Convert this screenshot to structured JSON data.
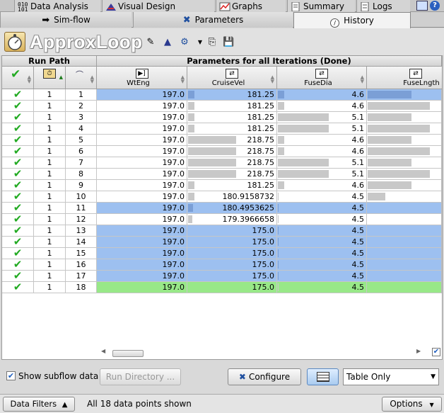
{
  "tabs_row1": [
    {
      "label": "Data Analysis",
      "icon": "data-analysis-icon"
    },
    {
      "label": "Visual Design",
      "icon": "visual-design-icon"
    },
    {
      "label": "Graphs",
      "icon": "graphs-icon"
    },
    {
      "label": "Summary",
      "icon": "summary-icon"
    },
    {
      "label": "Logs",
      "icon": "logs-icon"
    }
  ],
  "tabs_row2": [
    {
      "label": "Sim-flow",
      "icon": "arrow-right-icon"
    },
    {
      "label": "Parameters",
      "icon": "parameters-icon"
    },
    {
      "label": "History",
      "icon": "history-icon",
      "active": true
    }
  ],
  "title": "ApproxLoop",
  "table": {
    "group_run_path": "Run Path",
    "group_params": "Parameters for all Iterations (Done)",
    "columns": [
      "WtEng",
      "CruiseVel",
      "FuseDia",
      "FuseLngth"
    ],
    "rows": [
      {
        "run": "1",
        "iter": "1",
        "WtEng": "197.0",
        "CruiseVel": "181.25",
        "FuseDia": "4.6",
        "FuseLngth": "",
        "style": "blue",
        "bars": [
          0.0,
          0.07,
          0.07,
          0.6
        ]
      },
      {
        "run": "1",
        "iter": "2",
        "WtEng": "197.0",
        "CruiseVel": "181.25",
        "FuseDia": "4.6",
        "FuseLngth": "",
        "style": "white",
        "bars": [
          0.0,
          0.07,
          0.07,
          0.85
        ]
      },
      {
        "run": "1",
        "iter": "3",
        "WtEng": "197.0",
        "CruiseVel": "181.25",
        "FuseDia": "5.1",
        "FuseLngth": "",
        "style": "white",
        "bars": [
          0.0,
          0.07,
          0.58,
          0.6
        ]
      },
      {
        "run": "1",
        "iter": "4",
        "WtEng": "197.0",
        "CruiseVel": "181.25",
        "FuseDia": "5.1",
        "FuseLngth": "",
        "style": "white",
        "bars": [
          0.0,
          0.07,
          0.58,
          0.85
        ]
      },
      {
        "run": "1",
        "iter": "5",
        "WtEng": "197.0",
        "CruiseVel": "218.75",
        "FuseDia": "4.6",
        "FuseLngth": "",
        "style": "white",
        "bars": [
          0.0,
          0.55,
          0.07,
          0.6
        ]
      },
      {
        "run": "1",
        "iter": "6",
        "WtEng": "197.0",
        "CruiseVel": "218.75",
        "FuseDia": "4.6",
        "FuseLngth": "",
        "style": "white",
        "bars": [
          0.0,
          0.55,
          0.07,
          0.85
        ]
      },
      {
        "run": "1",
        "iter": "7",
        "WtEng": "197.0",
        "CruiseVel": "218.75",
        "FuseDia": "5.1",
        "FuseLngth": "",
        "style": "white",
        "bars": [
          0.0,
          0.55,
          0.58,
          0.6
        ]
      },
      {
        "run": "1",
        "iter": "8",
        "WtEng": "197.0",
        "CruiseVel": "218.75",
        "FuseDia": "5.1",
        "FuseLngth": "",
        "style": "white",
        "bars": [
          0.0,
          0.55,
          0.58,
          0.85
        ]
      },
      {
        "run": "1",
        "iter": "9",
        "WtEng": "197.0",
        "CruiseVel": "181.25",
        "FuseDia": "4.6",
        "FuseLngth": "",
        "style": "white",
        "bars": [
          0.0,
          0.07,
          0.07,
          0.6
        ]
      },
      {
        "run": "1",
        "iter": "10",
        "WtEng": "197.0",
        "CruiseVel": "180.9158732",
        "FuseDia": "4.5",
        "FuseLngth": "",
        "style": "white",
        "bars": [
          0.0,
          0.07,
          0.01,
          0.24
        ]
      },
      {
        "run": "1",
        "iter": "11",
        "WtEng": "197.0",
        "CruiseVel": "180.4953625",
        "FuseDia": "4.5",
        "FuseLngth": "",
        "style": "blue",
        "bars": [
          0.0,
          0.06,
          0.01,
          0.0
        ]
      },
      {
        "run": "1",
        "iter": "12",
        "WtEng": "197.0",
        "CruiseVel": "179.3966658",
        "FuseDia": "4.5",
        "FuseLngth": "",
        "style": "white",
        "bars": [
          0.0,
          0.05,
          0.01,
          0.0
        ]
      },
      {
        "run": "1",
        "iter": "13",
        "WtEng": "197.0",
        "CruiseVel": "175.0",
        "FuseDia": "4.5",
        "FuseLngth": "",
        "style": "blue",
        "bars": [
          0.0,
          0.0,
          0.01,
          0.0
        ]
      },
      {
        "run": "1",
        "iter": "14",
        "WtEng": "197.0",
        "CruiseVel": "175.0",
        "FuseDia": "4.5",
        "FuseLngth": "",
        "style": "blue",
        "bars": [
          0.0,
          0.0,
          0.01,
          0.0
        ]
      },
      {
        "run": "1",
        "iter": "15",
        "WtEng": "197.0",
        "CruiseVel": "175.0",
        "FuseDia": "4.5",
        "FuseLngth": "",
        "style": "blue",
        "bars": [
          0.0,
          0.0,
          0.01,
          0.0
        ]
      },
      {
        "run": "1",
        "iter": "16",
        "WtEng": "197.0",
        "CruiseVel": "175.0",
        "FuseDia": "4.5",
        "FuseLngth": "",
        "style": "blue",
        "bars": [
          0.0,
          0.0,
          0.01,
          0.0
        ]
      },
      {
        "run": "1",
        "iter": "17",
        "WtEng": "197.0",
        "CruiseVel": "175.0",
        "FuseDia": "4.5",
        "FuseLngth": "",
        "style": "blue",
        "bars": [
          0.0,
          0.0,
          0.01,
          0.0
        ]
      },
      {
        "run": "1",
        "iter": "18",
        "WtEng": "197.0",
        "CruiseVel": "175.0",
        "FuseDia": "4.5",
        "FuseLngth": "",
        "style": "green",
        "bars": [
          0.0,
          0.0,
          0.01,
          0.0
        ]
      }
    ]
  },
  "controls": {
    "show_subflow_label": "Show subflow data",
    "show_subflow_checked": true,
    "run_directory_label": "Run Directory ...",
    "configure_label": "Configure",
    "view_mode": "Table Only"
  },
  "status": {
    "data_filters_label": "Data Filters",
    "points_text": "All 18 data points shown",
    "options_label": "Options"
  },
  "colors": {
    "row_blue": "#9dc0f0",
    "row_green": "#98e888",
    "check_green": "#22aa22"
  }
}
